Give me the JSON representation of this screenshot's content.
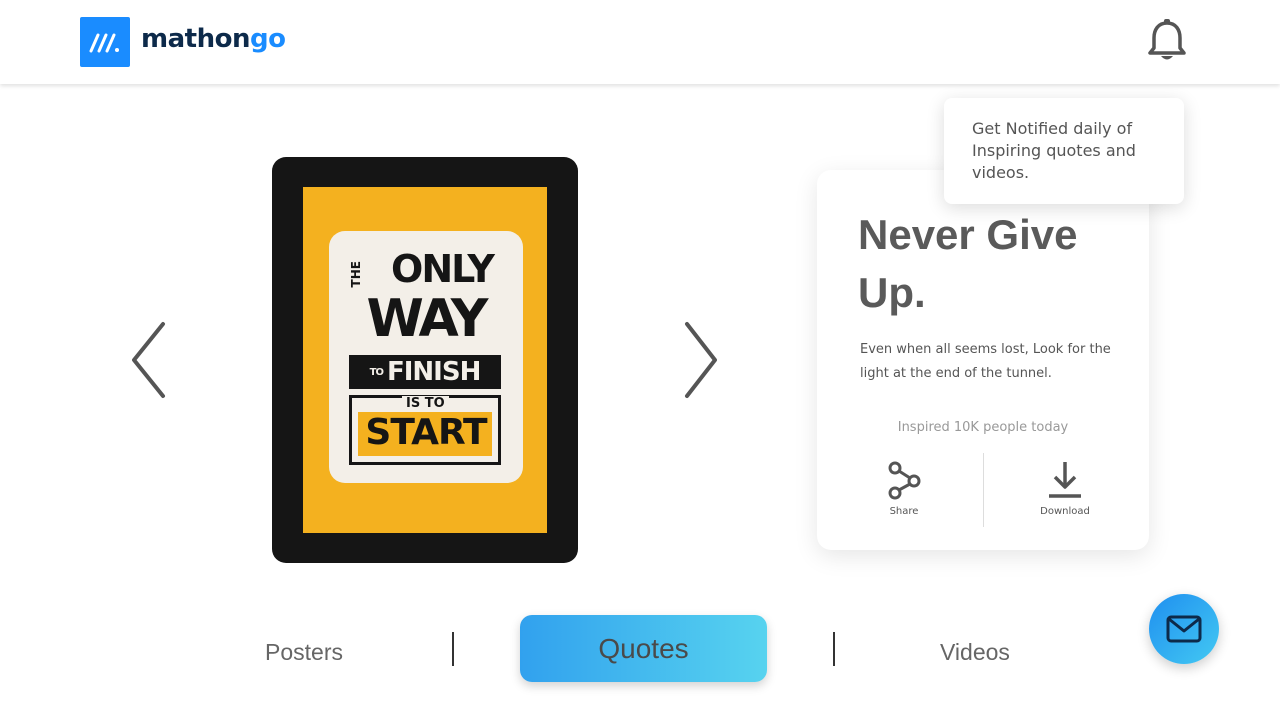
{
  "brand": {
    "name_part1": "mathon",
    "name_part2": "go",
    "color": "#1a8cff"
  },
  "notification": {
    "tooltip_text": "Get Notified daily of Inspiring quotes and videos."
  },
  "poster": {
    "lines": {
      "the": "THE",
      "only": "ONLY",
      "way": "WAY",
      "to": "TO",
      "finish": "FINISH",
      "is_to": "IS TO",
      "start": "START"
    }
  },
  "quote_card": {
    "title": "Never Give Up.",
    "description": "Even when all seems lost, Look for the light at the end of the tunnel.",
    "stat": "Inspired 10K people today",
    "share_label": "Share",
    "download_label": "Download"
  },
  "tabs": {
    "posters": "Posters",
    "quotes": "Quotes",
    "videos": "Videos",
    "active": "Quotes"
  },
  "icons": {
    "logo": "mathongo-logo-icon",
    "bell": "bell-icon",
    "prev": "chevron-left-icon",
    "next": "chevron-right-icon",
    "share": "share-icon",
    "download": "download-icon",
    "mail": "mail-icon"
  },
  "colors": {
    "accent": "#1a8cff",
    "tab_gradient_start": "#31a1ee",
    "tab_gradient_end": "#57d3ef",
    "poster_yellow": "#f4b11f"
  }
}
